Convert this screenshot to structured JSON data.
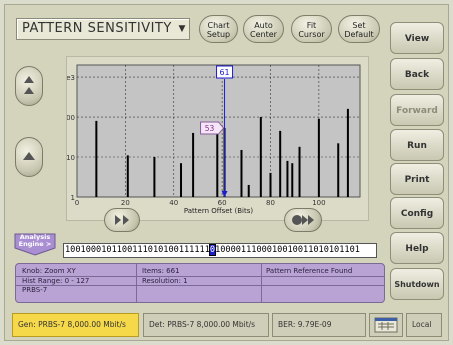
{
  "title": "PATTERN SENSITIVITY",
  "top_buttons": [
    {
      "label": "Chart\nSetup"
    },
    {
      "label": "Auto\nCenter"
    },
    {
      "label": "Fit\nCursor"
    },
    {
      "label": "Set\nDefault"
    }
  ],
  "side_buttons": [
    "View",
    "Back",
    "Forward",
    "Run",
    "Print",
    "Config",
    "Help",
    "Shutdown"
  ],
  "chart_data": {
    "type": "bar",
    "xlabel": "Pattern Offset (Bits)",
    "ylabel": "",
    "xlim": [
      0,
      117
    ],
    "ylim": [
      1,
      2000
    ],
    "log_y": true,
    "x_ticks": [
      "0",
      "20",
      "40",
      "60",
      "80",
      "100"
    ],
    "y_ticks": [
      "1",
      "10",
      "100",
      "1e3"
    ],
    "grid": true,
    "x": [
      8,
      21,
      32,
      43,
      48,
      58,
      61,
      68,
      71,
      76,
      80,
      84,
      87,
      89,
      92,
      100,
      108,
      112
    ],
    "values": [
      80,
      11,
      10,
      7,
      40,
      65,
      53,
      15,
      2,
      100,
      4,
      45,
      8,
      7,
      18,
      90,
      22,
      160
    ],
    "cursor_x": 61,
    "cursor_label": "61",
    "marker_label": "53",
    "marker_value": 53
  },
  "analysis_engine": "Analysis\nEngine >",
  "bitstream": {
    "before": "1001000101100111010100111111",
    "cursor_bit": "0",
    "after": "1000011100010010011010101101"
  },
  "info": {
    "knob": "Knob:  Zoom XY",
    "hist_range": "Hist Range: 0 - 127",
    "pattern": "PRBS-7",
    "items": "Items: 661",
    "resolution": "Resolution: 1",
    "message": "Pattern Reference Found"
  },
  "status": {
    "gen": "Gen: PRBS-7  8,000.00 Mbit/s",
    "det": "Det: PRBS-7  8,000.00 Mbit/s",
    "ber": "BER: 9.79E-09",
    "local": "Local"
  },
  "colors": {
    "plot_bg": "#c4c4c4",
    "bar": "#000000",
    "cursor": "#1c1cd0",
    "gen_highlight": "#f6d94a",
    "info_panel": "#b9a3d4"
  }
}
